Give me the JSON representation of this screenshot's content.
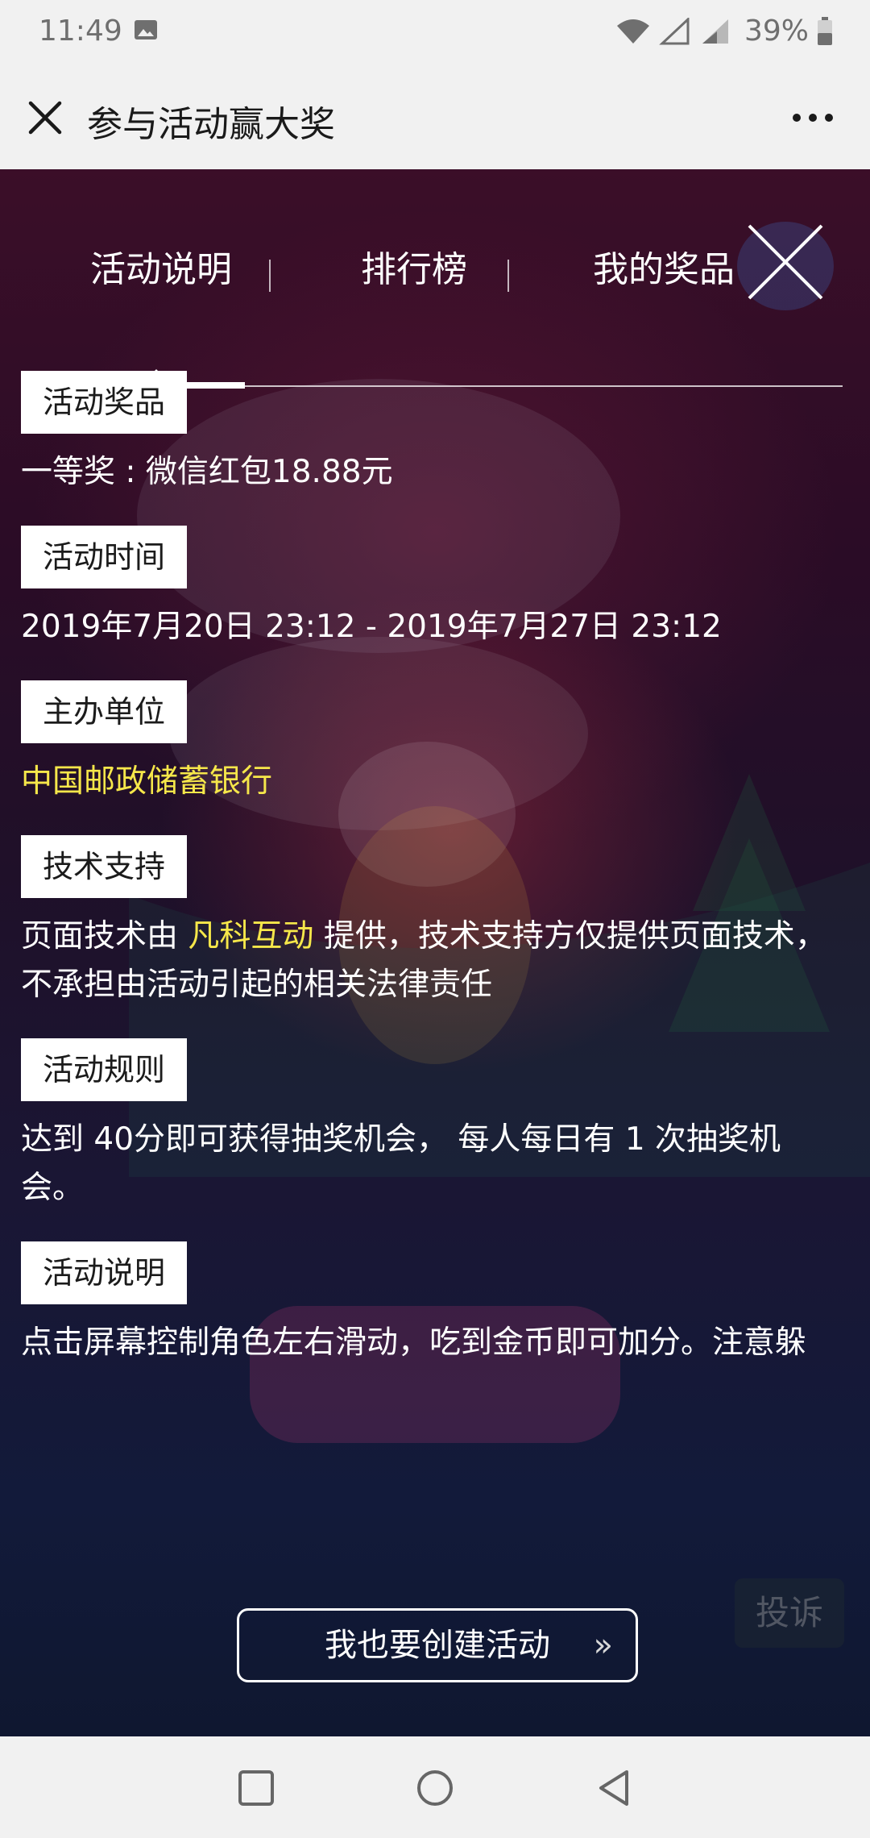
{
  "status_bar": {
    "time": "11:49",
    "battery": "39%",
    "icons": [
      "image-icon",
      "wifi-icon",
      "signal-icon",
      "signal-icon",
      "battery-icon"
    ]
  },
  "title_bar": {
    "title": "参与活动赢大奖",
    "close_icon": "close-icon",
    "more_icon": "more-icon"
  },
  "tabs": [
    {
      "label": "活动说明",
      "active": true
    },
    {
      "label": "排行榜",
      "active": false
    },
    {
      "label": "我的奖品",
      "active": false
    }
  ],
  "sections": [
    {
      "label": "活动奖品",
      "text": "一等奖 : 微信红包18.88元"
    },
    {
      "label": "活动时间",
      "text": "2019年7月20日 23:12 - 2019年7月27日 23:12"
    },
    {
      "label": "主办单位",
      "text": "中国邮政储蓄银行"
    },
    {
      "label": "技术支持",
      "text_before": "页面技术由 ",
      "highlight": "凡科互动",
      "text_after": " 提供，技术支持方仅提供页面技术，不承担由活动引起的相关法律责任"
    },
    {
      "label": "活动规则",
      "text": "达到 40分即可获得抽奖机会， 每人每日有 1 次抽奖机会。"
    },
    {
      "label": "活动说明",
      "text": "点击屏幕控制角色左右滑动，吃到金币即可加分。注意躲"
    }
  ],
  "create_button": {
    "label": "我也要创建活动",
    "arrows": "»"
  },
  "complaint_button": {
    "label": "投诉"
  },
  "colors": {
    "highlight": "#f6e74a",
    "background": "#1a1634"
  }
}
